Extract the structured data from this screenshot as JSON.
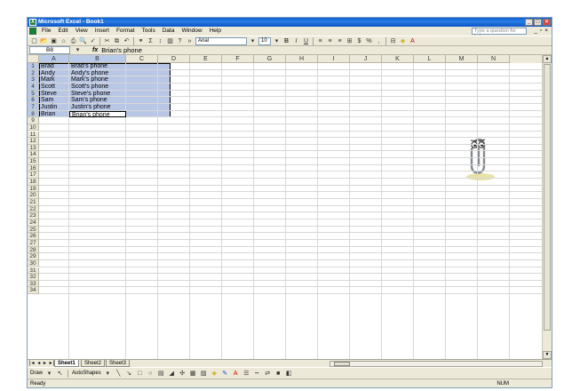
{
  "app": {
    "title": "Microsoft Excel - Book1"
  },
  "menus": [
    "File",
    "Edit",
    "View",
    "Insert",
    "Format",
    "Tools",
    "Data",
    "Window",
    "Help"
  ],
  "help_box": {
    "placeholder": "Type a question for help"
  },
  "toolbar": {
    "font_name": "Arial",
    "font_size": "10",
    "bold": "B",
    "italic": "I",
    "underline": "U",
    "currency": "$",
    "percent": "%",
    "comma": ","
  },
  "formula_bar": {
    "name_box": "B8",
    "fx": "fx",
    "content": "Brian's phone"
  },
  "columns": [
    "A",
    "B",
    "C",
    "D",
    "E",
    "F",
    "G",
    "H",
    "I",
    "J",
    "K",
    "L",
    "M",
    "N"
  ],
  "rows": [
    "1",
    "2",
    "3",
    "4",
    "5",
    "6",
    "7",
    "8",
    "9",
    "10",
    "11",
    "12",
    "13",
    "14",
    "15",
    "16",
    "17",
    "18",
    "19",
    "20",
    "21",
    "22",
    "23",
    "24",
    "25",
    "26",
    "27",
    "28",
    "29",
    "30",
    "31",
    "32",
    "33",
    "34"
  ],
  "cells": [
    {
      "a": "Brad",
      "b": "Brad's phone"
    },
    {
      "a": "Andy",
      "b": "Andy's phone"
    },
    {
      "a": "Mark",
      "b": "Mark's phone"
    },
    {
      "a": "Scott",
      "b": "Scott's phone"
    },
    {
      "a": "Steve",
      "b": "Steve's phone"
    },
    {
      "a": "Sam",
      "b": "Sam's phone"
    },
    {
      "a": "Justin",
      "b": "Justin's phone"
    },
    {
      "a": "Brian",
      "b": "Brian's phone"
    }
  ],
  "sheets": [
    "Sheet1",
    "Sheet2",
    "Sheet3"
  ],
  "drawbar": {
    "draw": "Draw",
    "autoshapes": "AutoShapes"
  },
  "status": {
    "left": "Ready",
    "right": "NUM"
  },
  "colors": {
    "selection": "#b9c7e6",
    "title_blue": "#0a5fd8",
    "chrome": "#ece9d8"
  }
}
